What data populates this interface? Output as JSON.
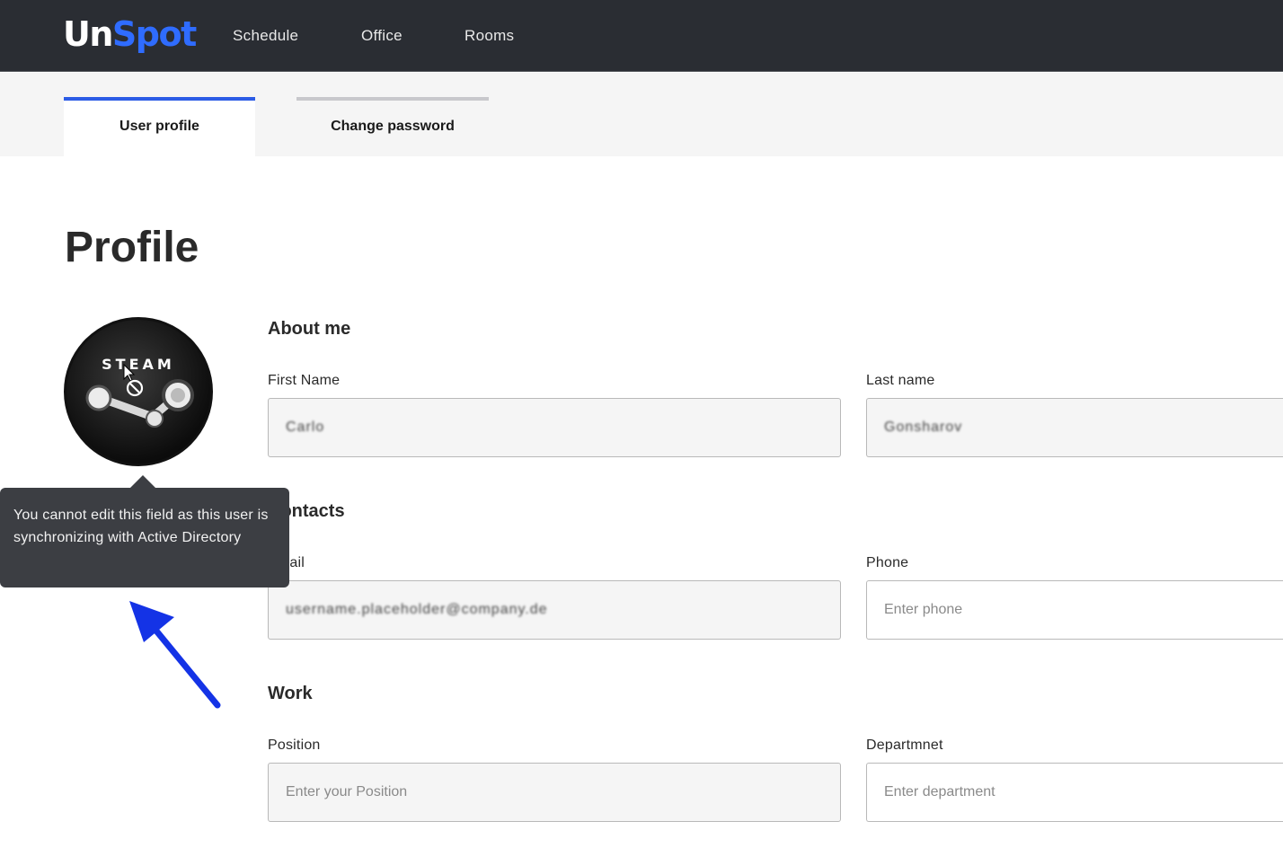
{
  "brand": {
    "part1": "Un",
    "part2": "Spot"
  },
  "nav": {
    "items": [
      "Schedule",
      "Office",
      "Rooms"
    ]
  },
  "tabs": [
    {
      "label": "User profile",
      "active": true
    },
    {
      "label": "Change password",
      "active": false
    }
  ],
  "page_title": "Profile",
  "avatar": {
    "logo_text": "STEAM"
  },
  "about": {
    "heading": "About me",
    "first_name_label": "First Name",
    "first_name_value": "Carlo",
    "last_name_label": "Last name",
    "last_name_value": "Gonsharov"
  },
  "contacts": {
    "heading": "Contacts",
    "email_label": "Email",
    "email_value": "username.placeholder@company.de",
    "phone_label": "Phone",
    "phone_placeholder": "Enter phone"
  },
  "work": {
    "heading": "Work",
    "position_label": "Position",
    "position_placeholder": "Enter your Position",
    "department_label": "Departmnet",
    "department_placeholder": "Enter department"
  },
  "tooltip": {
    "text": "You cannot edit this field as this user is synchronizing with Active Directory"
  },
  "colors": {
    "topbar": "#2a2d33",
    "accent": "#2b5ce6",
    "annotation_arrow": "#1433e6"
  }
}
